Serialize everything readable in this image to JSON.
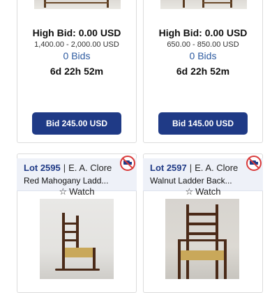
{
  "top_cards": [
    {
      "high_bid": "High Bid: 0.00 USD",
      "estimate": "1,400.00 - 2,000.00 USD",
      "bids": "0 Bids",
      "time_left": "6d 22h 52m",
      "bid_button": "Bid 245.00 USD"
    },
    {
      "high_bid": "High Bid: 0.00 USD",
      "estimate": "650.00 - 850.00 USD",
      "bids": "0 Bids",
      "time_left": "6d 22h 52m",
      "bid_button": "Bid 145.00 USD"
    }
  ],
  "bottom_cards": [
    {
      "lot": "Lot 2595",
      "seller": "E. A. Clore",
      "title": "Red Mahogany Ladd...",
      "watch": "Watch"
    },
    {
      "lot": "Lot 2597",
      "seller": "E. A. Clore",
      "title": "Walnut Ladder Back...",
      "watch": "Watch"
    }
  ],
  "colors": {
    "accent": "#1f3a86",
    "link": "#2c5aa0",
    "no_ship": "#d93a3a",
    "header_bg": "#eef1f8"
  },
  "icons": [
    "star-outline-icon",
    "no-shipping-truck-icon"
  ]
}
